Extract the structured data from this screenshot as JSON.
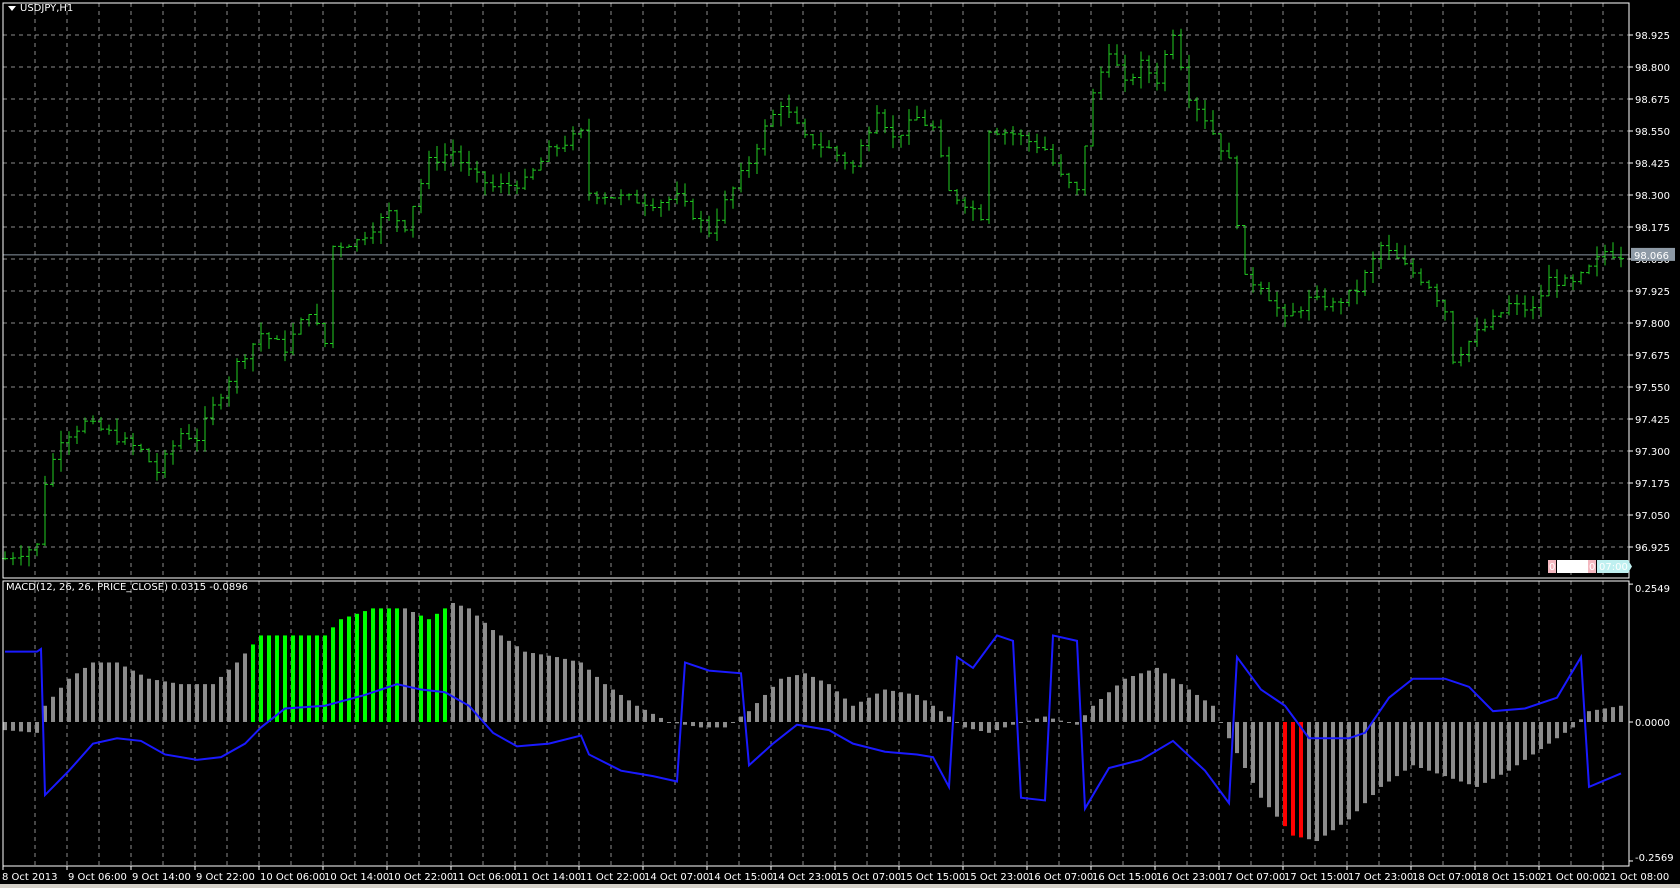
{
  "window": {
    "symbol_title": "USDJPY,H1"
  },
  "indicator": {
    "label": "MACD(12, 26, 26, PRICE_CLOSE) 0.0315 -0.0896"
  },
  "markers": {
    "left_num": "0",
    "left_time": "02:30",
    "right_num": "0",
    "right_time": "07:00"
  },
  "colors": {
    "bar": "#22cc22",
    "hist_gray": "#8c8c8c",
    "hist_up": "#00ff00",
    "hist_down": "#ff0000",
    "signal": "#1a1aff",
    "grid": "#8a8a8a",
    "price_tag": "#8e9aa6"
  },
  "chart_data": [
    {
      "type": "ohlc",
      "title": "USDJPY,H1",
      "ylim": [
        96.85,
        99.0
      ],
      "y_ticks": [
        "98.925",
        "98.800",
        "98.675",
        "98.550",
        "98.425",
        "98.300",
        "98.175",
        "98.050",
        "97.925",
        "97.800",
        "97.675",
        "97.550",
        "97.425",
        "97.300",
        "97.175",
        "97.050",
        "96.925"
      ],
      "current_price": "98.066",
      "x_labels": [
        "8 Oct 2013",
        "9 Oct 06:00",
        "9 Oct 14:00",
        "9 Oct 22:00",
        "10 Oct 06:00",
        "10 Oct 14:00",
        "10 Oct 22:00",
        "11 Oct 06:00",
        "11 Oct 14:00",
        "11 Oct 22:00",
        "14 Oct 07:00",
        "14 Oct 15:00",
        "14 Oct 23:00",
        "15 Oct 07:00",
        "15 Oct 15:00",
        "15 Oct 23:00",
        "16 Oct 07:00",
        "16 Oct 15:00",
        "16 Oct 23:00",
        "17 Oct 07:00",
        "17 Oct 15:00",
        "17 Oct 23:00",
        "18 Oct 07:00",
        "18 Oct 15:00",
        "21 Oct 00:00",
        "21 Oct 08:00"
      ],
      "bar_count": 203,
      "close_anchors": [
        [
          0,
          96.88
        ],
        [
          4,
          96.93
        ],
        [
          5,
          97.18
        ],
        [
          7,
          97.35
        ],
        [
          10,
          97.41
        ],
        [
          13,
          97.37
        ],
        [
          17,
          97.3
        ],
        [
          19,
          97.22
        ],
        [
          22,
          97.37
        ],
        [
          24,
          97.35
        ],
        [
          26,
          97.47
        ],
        [
          29,
          97.64
        ],
        [
          32,
          97.76
        ],
        [
          35,
          97.7
        ],
        [
          38,
          97.85
        ],
        [
          40,
          97.72
        ],
        [
          41,
          98.1
        ],
        [
          44,
          98.12
        ],
        [
          48,
          98.23
        ],
        [
          50,
          98.18
        ],
        [
          53,
          98.43
        ],
        [
          56,
          98.47
        ],
        [
          58,
          98.39
        ],
        [
          61,
          98.33
        ],
        [
          65,
          98.35
        ],
        [
          68,
          98.47
        ],
        [
          72,
          98.54
        ],
        [
          73,
          98.31
        ],
        [
          77,
          98.29
        ],
        [
          81,
          98.27
        ],
        [
          84,
          98.29
        ],
        [
          88,
          98.16
        ],
        [
          90,
          98.27
        ],
        [
          93,
          98.43
        ],
        [
          95,
          98.56
        ],
        [
          97,
          98.66
        ],
        [
          100,
          98.52
        ],
        [
          103,
          98.48
        ],
        [
          106,
          98.41
        ],
        [
          109,
          98.64
        ],
        [
          111,
          98.52
        ],
        [
          114,
          98.6
        ],
        [
          116,
          98.56
        ],
        [
          118,
          98.31
        ],
        [
          120,
          98.27
        ],
        [
          122,
          98.22
        ],
        [
          123,
          98.56
        ],
        [
          126,
          98.54
        ],
        [
          130,
          98.48
        ],
        [
          132,
          98.37
        ],
        [
          134,
          98.31
        ],
        [
          136,
          98.69
        ],
        [
          138,
          98.87
        ],
        [
          140,
          98.73
        ],
        [
          142,
          98.81
        ],
        [
          144,
          98.75
        ],
        [
          146,
          98.94
        ],
        [
          148,
          98.69
        ],
        [
          150,
          98.6
        ],
        [
          153,
          98.43
        ],
        [
          155,
          97.97
        ],
        [
          157,
          97.95
        ],
        [
          160,
          97.81
        ],
        [
          163,
          97.89
        ],
        [
          166,
          97.87
        ],
        [
          169,
          97.93
        ],
        [
          172,
          98.1
        ],
        [
          175,
          98.02
        ],
        [
          178,
          97.95
        ],
        [
          180,
          97.85
        ],
        [
          181,
          97.66
        ],
        [
          184,
          97.76
        ],
        [
          186,
          97.81
        ],
        [
          188,
          97.87
        ],
        [
          191,
          97.85
        ],
        [
          193,
          97.97
        ],
        [
          196,
          97.95
        ],
        [
          198,
          98.01
        ],
        [
          200,
          98.08
        ],
        [
          202,
          98.066
        ]
      ]
    },
    {
      "type": "bar",
      "title": "MACD(12, 26, 26, PRICE_CLOSE)",
      "ylim": [
        -0.2569,
        0.2549
      ],
      "y_ticks": [
        "0.2549",
        "0.0000",
        "-0.2569"
      ],
      "histogram_anchors": [
        [
          0,
          -0.015
        ],
        [
          4,
          -0.02
        ],
        [
          5,
          0.03
        ],
        [
          8,
          0.08
        ],
        [
          11,
          0.11
        ],
        [
          14,
          0.11
        ],
        [
          18,
          0.08
        ],
        [
          22,
          0.07
        ],
        [
          26,
          0.07
        ],
        [
          29,
          0.11
        ],
        [
          32,
          0.16
        ],
        [
          36,
          0.16
        ],
        [
          40,
          0.16
        ],
        [
          42,
          0.19
        ],
        [
          46,
          0.21
        ],
        [
          50,
          0.21
        ],
        [
          53,
          0.19
        ],
        [
          56,
          0.22
        ],
        [
          58,
          0.21
        ],
        [
          61,
          0.17
        ],
        [
          65,
          0.13
        ],
        [
          69,
          0.12
        ],
        [
          72,
          0.11
        ],
        [
          75,
          0.07
        ],
        [
          79,
          0.03
        ],
        [
          83,
          0.0
        ],
        [
          87,
          -0.01
        ],
        [
          90,
          -0.01
        ],
        [
          93,
          0.02
        ],
        [
          97,
          0.08
        ],
        [
          100,
          0.09
        ],
        [
          103,
          0.07
        ],
        [
          106,
          0.03
        ],
        [
          110,
          0.06
        ],
        [
          114,
          0.05
        ],
        [
          118,
          0.01
        ],
        [
          120,
          -0.01
        ],
        [
          123,
          -0.02
        ],
        [
          126,
          -0.005
        ],
        [
          130,
          0.01
        ],
        [
          134,
          -0.005
        ],
        [
          136,
          0.03
        ],
        [
          140,
          0.08
        ],
        [
          144,
          0.1
        ],
        [
          148,
          0.06
        ],
        [
          151,
          0.03
        ],
        [
          153,
          -0.03
        ],
        [
          157,
          -0.14
        ],
        [
          161,
          -0.21
        ],
        [
          164,
          -0.22
        ],
        [
          168,
          -0.18
        ],
        [
          172,
          -0.12
        ],
        [
          176,
          -0.08
        ],
        [
          180,
          -0.1
        ],
        [
          184,
          -0.12
        ],
        [
          188,
          -0.09
        ],
        [
          192,
          -0.05
        ],
        [
          196,
          -0.01
        ],
        [
          198,
          0.02
        ],
        [
          202,
          0.03
        ]
      ],
      "up_ranges": [
        [
          31,
          39
        ],
        [
          40,
          49
        ],
        [
          52,
          55
        ]
      ],
      "down_ranges": [
        [
          160,
          162
        ]
      ],
      "signal_anchors": [
        [
          0,
          0.13
        ],
        [
          4,
          0.13
        ],
        [
          4.5,
          0.135
        ],
        [
          5,
          -0.135
        ],
        [
          8,
          -0.09
        ],
        [
          11,
          -0.04
        ],
        [
          14,
          -0.03
        ],
        [
          17,
          -0.035
        ],
        [
          20,
          -0.06
        ],
        [
          24,
          -0.07
        ],
        [
          27,
          -0.065
        ],
        [
          30,
          -0.04
        ],
        [
          32,
          -0.01
        ],
        [
          35,
          0.025
        ],
        [
          40,
          0.03
        ],
        [
          45,
          0.05
        ],
        [
          49,
          0.07
        ],
        [
          52,
          0.06
        ],
        [
          55,
          0.055
        ],
        [
          58,
          0.03
        ],
        [
          61,
          -0.02
        ],
        [
          64,
          -0.045
        ],
        [
          68,
          -0.04
        ],
        [
          72,
          -0.025
        ],
        [
          73,
          -0.06
        ],
        [
          77,
          -0.09
        ],
        [
          81,
          -0.1
        ],
        [
          84,
          -0.11
        ],
        [
          85,
          0.11
        ],
        [
          88,
          0.095
        ],
        [
          92,
          0.09
        ],
        [
          93,
          -0.08
        ],
        [
          96,
          -0.04
        ],
        [
          99,
          -0.005
        ],
        [
          103,
          -0.015
        ],
        [
          106,
          -0.04
        ],
        [
          110,
          -0.055
        ],
        [
          114,
          -0.06
        ],
        [
          116,
          -0.065
        ],
        [
          118,
          -0.12
        ],
        [
          119,
          0.12
        ],
        [
          121,
          0.1
        ],
        [
          124,
          0.16
        ],
        [
          126,
          0.15
        ],
        [
          127,
          -0.14
        ],
        [
          130,
          -0.145
        ],
        [
          131,
          0.16
        ],
        [
          134,
          0.15
        ],
        [
          135,
          -0.16
        ],
        [
          138,
          -0.085
        ],
        [
          142,
          -0.07
        ],
        [
          146,
          -0.035
        ],
        [
          150,
          -0.09
        ],
        [
          153,
          -0.15
        ],
        [
          154,
          0.12
        ],
        [
          157,
          0.06
        ],
        [
          160,
          0.03
        ],
        [
          163,
          -0.03
        ],
        [
          168,
          -0.03
        ],
        [
          170,
          -0.02
        ],
        [
          173,
          0.045
        ],
        [
          176,
          0.08
        ],
        [
          180,
          0.08
        ],
        [
          183,
          0.065
        ],
        [
          186,
          0.02
        ],
        [
          190,
          0.025
        ],
        [
          194,
          0.045
        ],
        [
          197,
          0.12
        ],
        [
          198,
          -0.12
        ],
        [
          202,
          -0.095
        ]
      ]
    }
  ]
}
